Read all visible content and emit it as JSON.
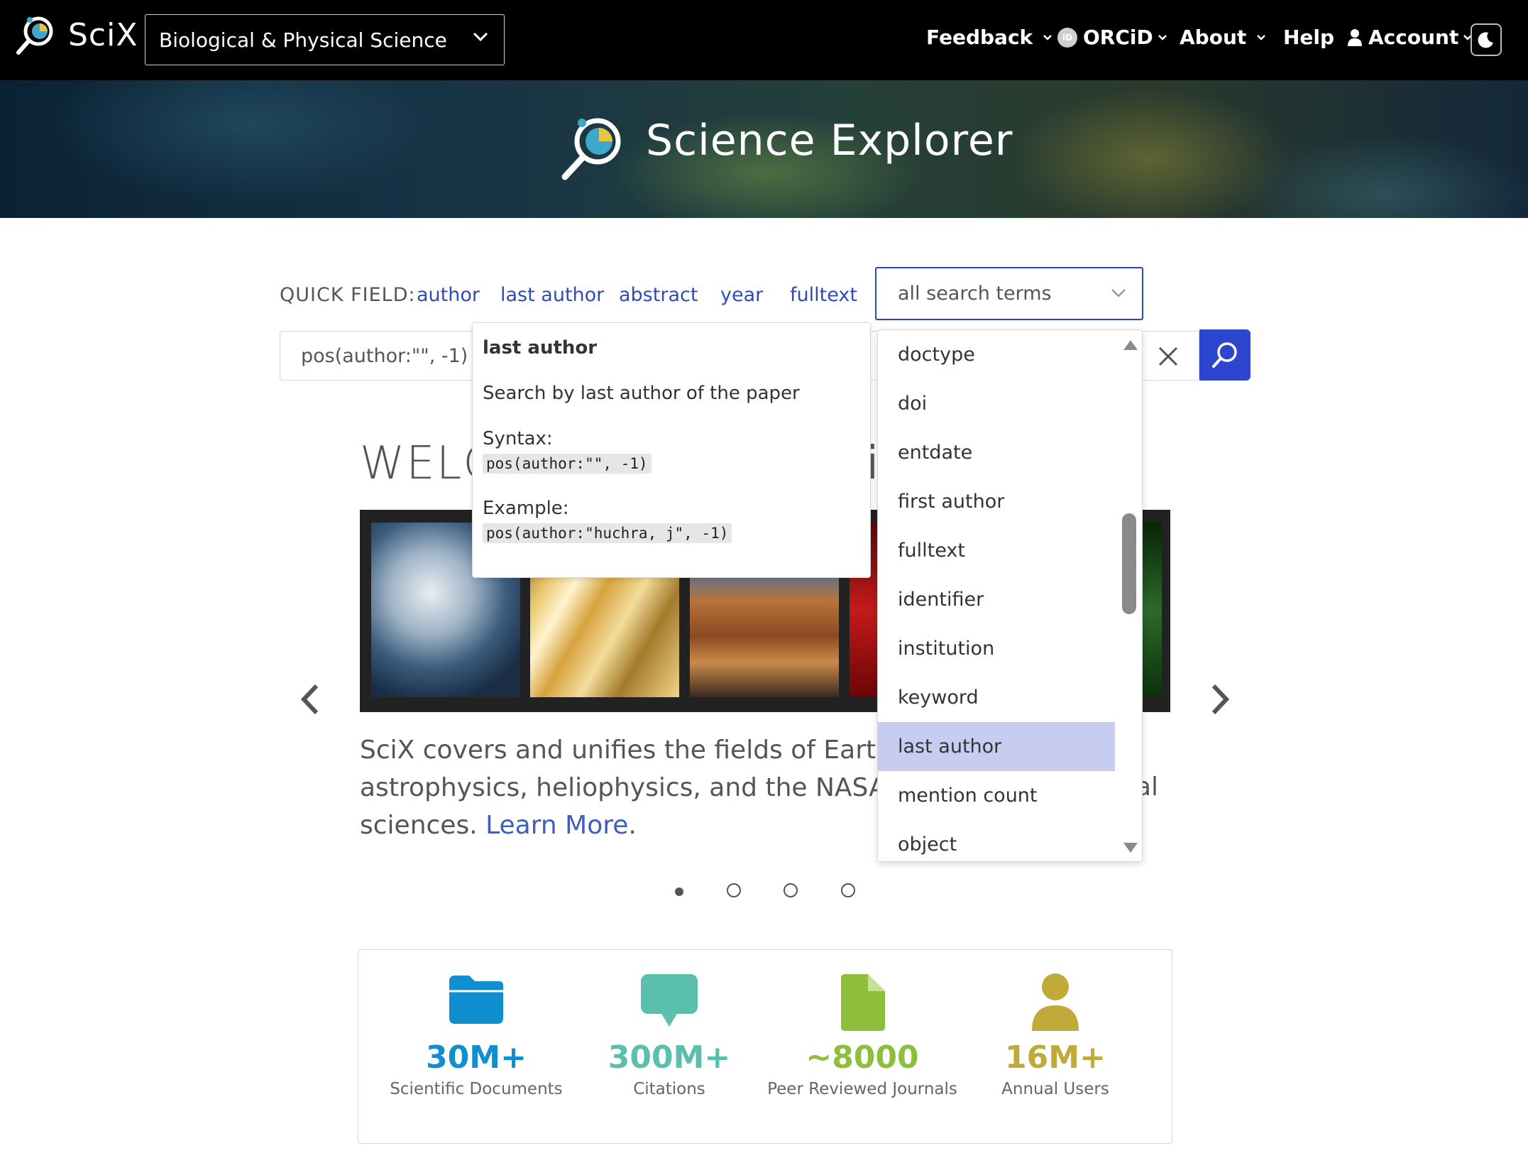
{
  "app": {
    "brand": "SciX",
    "discipline": "Biological & Physical Science"
  },
  "nav": {
    "feedback": "Feedback",
    "orcid": "ORCiD",
    "orcid_badge": "iD",
    "about": "About",
    "help": "Help",
    "account": "Account"
  },
  "hero": {
    "title": "Science Explorer"
  },
  "quick_field": {
    "label": "QUICK FIELD:",
    "links": [
      "author",
      "last author",
      "abstract",
      "year",
      "fulltext"
    ],
    "select_value": "all search terms"
  },
  "search": {
    "value": "pos(author:\"\", -1)"
  },
  "tooltip": {
    "title": "last author",
    "description": "Search by last author of the paper",
    "syntax_label": "Syntax:",
    "syntax": "pos(author:\"\", -1)",
    "example_label": "Example:",
    "example": "pos(author:\"huchra, j\", -1)"
  },
  "dropdown": {
    "items": [
      "doctype",
      "doi",
      "entdate",
      "first author",
      "fulltext",
      "identifier",
      "institution",
      "keyword",
      "last author",
      "mention count",
      "object"
    ],
    "selected": "last author"
  },
  "welcome": {
    "heading_visible": "WELC",
    "heading_tail": "i",
    "description": "SciX covers and unifies the fields of Earth scien",
    "description_line2": "astrophysics, heliophysics, and the NASA-fund",
    "description_line3": "sciences. ",
    "learn_more": "Learn More",
    "period": ".",
    "description_tail": "al",
    "active_slide": 1,
    "slide_count": 4
  },
  "stats": [
    {
      "value": "30M+",
      "label": "Scientific Documents",
      "color": "#0f8fcf",
      "icon": "folder-icon"
    },
    {
      "value": "300M+",
      "label": "Citations",
      "color": "#5bbfae",
      "icon": "speech-bubble-icon"
    },
    {
      "value": "~8000",
      "label": "Peer Reviewed Journals",
      "color": "#8dbf3d",
      "icon": "document-icon"
    },
    {
      "value": "16M+",
      "label": "Annual Users",
      "color": "#c2aa3a",
      "icon": "user-icon"
    }
  ]
}
